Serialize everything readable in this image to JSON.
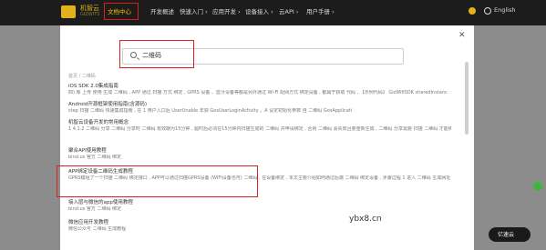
{
  "header": {
    "logo_text": "机智云",
    "logo_sub": "GIZWITS",
    "nav": [
      "文档中心",
      "开发概述",
      "快速入门 ›",
      "应用开发 ›",
      "设备接入 ›",
      "云API ›",
      "用户手册 ›"
    ],
    "lang": "English"
  },
  "search": {
    "value": "二维码"
  },
  "breadcrumb": "首页 / 二维码",
  "results": [
    {
      "title": "iOS SDK 2.0集成指南",
      "snippet": "四) 库 上传 使用 生成 二维码 , APP 通过 扫描 方式 绑定 , GPRS 设备 、蓝牙设备等都是另外通过 Wi-Fi 配网方式 绑定设备 , 都属于获取 代码 , 【示例代码】 GizWifiSDK sharedInstanc"
    },
    {
      "title": "Android开源框架使用指南(含源码)",
      "snippet": "step 扫描 二维码 快速集成指南 , 在 1 用户入口后 UserUnable 年获 GosUserLoginActivity 。A 设定初始化参数 自 二维码 GosApplicati"
    },
    {
      "title": "机智云设备开发的常用概念",
      "snippet": "1 4.1.2 二维码 分享 二维码 分享时 二维码 有效期为15分钟 , 超时后必须在15分钟内扫描生成的 二维码 并申请绑定 , 否则 二维码 会失效且要重新生成 , 二维码 分享需要 扫描 二维码 才能绑定 , 等待参数中 共享的 alarm"
    },
    {
      "title": "聚合API使用教程",
      "snippet": "bind.us 官方 二维码 绑定"
    },
    {
      "title": "APP绑定设备二维码生成教程",
      "snippet": "GPRS模组了一个扫描 二维码 绑定接口 , APP可以通过扫描GPRS设备 (WIFI设备也可) 二维码 , 在设备绑定 , 本文主要介绍如何通过后端 二维码 绑定设备 , 步骤过程 1 进入 二维码 生成网址 查看说明"
    },
    {
      "title": "接入层与微信的app使用教程",
      "snippet": "bind.us 官方 二维码 绑定"
    },
    {
      "title": "微信应用开发教程",
      "snippet": "微信公众号 二维码 生成教程"
    }
  ],
  "watermark": "ybx8.cn",
  "badge": "亿速云"
}
